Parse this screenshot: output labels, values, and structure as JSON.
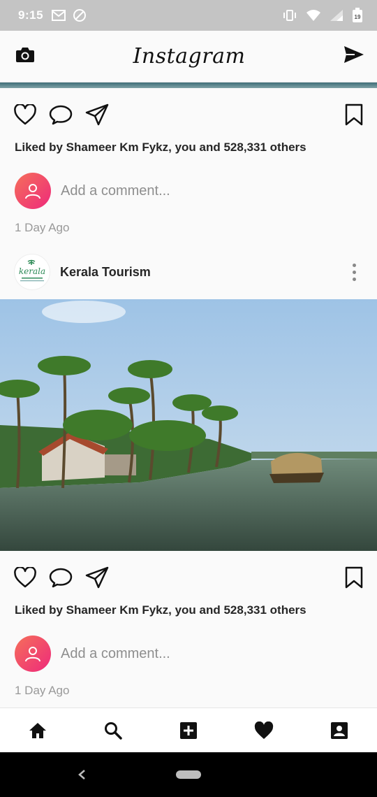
{
  "status_bar": {
    "time": "9:15",
    "battery_level": "19",
    "icons": [
      "gmail-icon",
      "do-not-disturb-icon",
      "vibrate-icon",
      "wifi-icon",
      "cellular-signal-icon",
      "battery-icon"
    ]
  },
  "header": {
    "brand": "Instagram",
    "camera_icon": "camera-icon",
    "direct_icon": "send-icon"
  },
  "posts": [
    {
      "likes_text": "Liked by Shameer Km Fykz, you and 528,331 others",
      "comment_placeholder": "Add a comment...",
      "time": "1 Day Ago"
    },
    {
      "username": "Kerala Tourism",
      "avatar_logo_text": "kerala",
      "likes_text": "Liked by Shameer Km Fykz, you and 528,331 others",
      "comment_placeholder": "Add a comment...",
      "time": "1 Day Ago"
    }
  ],
  "bottom_nav": {
    "items": [
      "home-icon",
      "search-icon",
      "add-post-icon",
      "activity-heart-icon",
      "profile-icon"
    ]
  },
  "colors": {
    "avatar_gradient_start": "#f56f5a",
    "avatar_gradient_end": "#ee2a7b",
    "status_bar": "#c4c4c4"
  }
}
